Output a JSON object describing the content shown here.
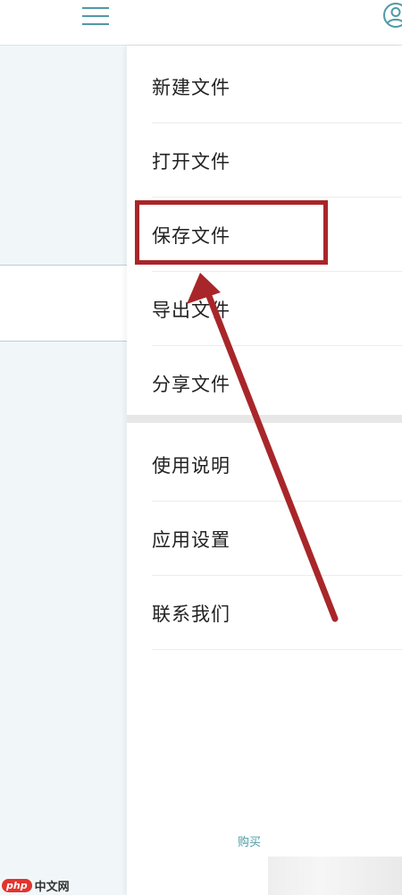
{
  "header": {
    "menu_icon": "hamburger-menu-icon",
    "account_icon": "user-avatar-icon"
  },
  "menu": {
    "file_items": [
      {
        "label": "新建文件"
      },
      {
        "label": "打开文件"
      },
      {
        "label": "保存文件"
      },
      {
        "label": "导出文件"
      },
      {
        "label": "分享文件"
      }
    ],
    "app_items": [
      {
        "label": "使用说明"
      },
      {
        "label": "应用设置"
      },
      {
        "label": "联系我们"
      }
    ]
  },
  "footer": {
    "buy_label": "购买"
  },
  "watermark": {
    "logo": "php",
    "site": "中文网"
  },
  "annotation": {
    "color": "#a8262a",
    "target": "保存文件"
  }
}
